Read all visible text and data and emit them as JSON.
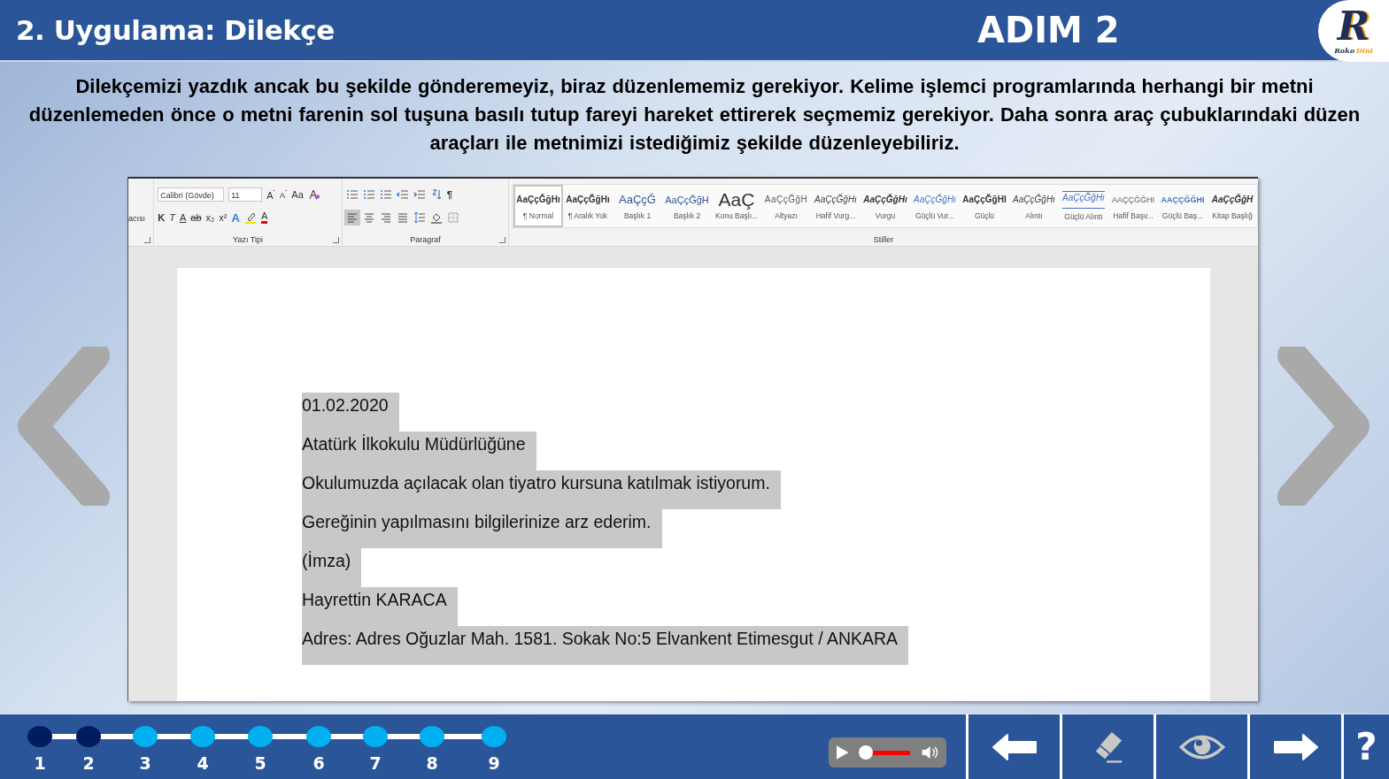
{
  "header": {
    "title": "2. Uygulama: Dilekçe",
    "step": "ADIM 2",
    "logo": {
      "letter": "R",
      "word_1": "Roko",
      "word_2": "Dini"
    }
  },
  "instructions": "Dilekçemizi yazdık ancak bu şekilde gönderemeyiz, biraz düzenlememiz gerekiyor. Kelime işlemci programlarında herhangi bir metni düzenlemeden önce o metni farenin sol tuşuna basılı tutup fareyi hareket ettirerek seçmemiz gerekiyor. Daha sonra araç çubuklarındaki düzen araçları ile metnimizi istediğimiz şekilde düzenleyebiliriz.",
  "ribbon": {
    "clipboard_fragment": "acısı",
    "font": {
      "name": "Calibri (Gövde)",
      "size": "11",
      "label": "Yazı Tipi",
      "row_1": [
        {
          "kind": "grow",
          "text": "A",
          "sign": "ˆ"
        },
        {
          "kind": "shrink",
          "text": "A",
          "sign": "ˇ"
        },
        {
          "kind": "case",
          "text": "Aa"
        },
        {
          "kind": "clear"
        }
      ],
      "row_2": [
        {
          "kind": "bold",
          "text": "K"
        },
        {
          "kind": "italic",
          "text": "T"
        },
        {
          "kind": "underline",
          "text": "A"
        },
        {
          "kind": "strike",
          "text": "ab"
        },
        {
          "kind": "sub",
          "text": "x₂"
        },
        {
          "kind": "sup",
          "text": "x²"
        },
        {
          "kind": "effect",
          "text": "A"
        },
        {
          "kind": "highlight"
        },
        {
          "kind": "color",
          "text": "A"
        }
      ]
    },
    "paragraph": {
      "label": "Paragraf",
      "row_1": [
        {
          "kind": "bullets"
        },
        {
          "kind": "numbering"
        },
        {
          "kind": "multilevel"
        },
        {
          "kind": "outdent"
        },
        {
          "kind": "indent"
        },
        {
          "kind": "sort"
        },
        {
          "kind": "marks",
          "text": "¶"
        }
      ],
      "alignment": [
        {
          "kind": "left",
          "selected": true
        },
        {
          "kind": "center",
          "selected": false
        },
        {
          "kind": "right",
          "selected": false
        },
        {
          "kind": "justify",
          "selected": false
        }
      ],
      "row_2": [
        {
          "kind": "spacing"
        },
        {
          "kind": "shading"
        },
        {
          "kind": "borders"
        }
      ]
    },
    "styles": {
      "label": "Stiller",
      "items": [
        {
          "preview": "AaÇçĞğHı",
          "name": "¶ Normal",
          "kind": "normal",
          "selected": true
        },
        {
          "preview": "AaÇçĞğHı",
          "name": "¶ Aralık Yok",
          "kind": "normal",
          "selected": false
        },
        {
          "preview": "AaÇçĞ",
          "name": "Başlık 1",
          "kind": "h1",
          "selected": false
        },
        {
          "preview": "AaÇçĞğH",
          "name": "Başlık 2",
          "kind": "h2",
          "selected": false
        },
        {
          "preview": "AaÇ",
          "name": "Konu Başlı...",
          "kind": "title",
          "selected": false
        },
        {
          "preview": "AaÇçĞğH",
          "name": "Altyazı",
          "kind": "subtitle",
          "selected": false
        },
        {
          "preview": "AaÇçĞğHı",
          "name": "Hafif Vurg...",
          "kind": "subtle",
          "selected": false
        },
        {
          "preview": "AaÇçĞğHı",
          "name": "Vurgu",
          "kind": "emphasis",
          "selected": false
        },
        {
          "preview": "AaÇçĞğHı",
          "name": "Güçlü Vur...",
          "kind": "intense",
          "selected": false
        },
        {
          "preview": "AaÇçĞğHI",
          "name": "Güçlü",
          "kind": "strong",
          "selected": false
        },
        {
          "preview": "AaÇçĞğHı",
          "name": "Alıntı",
          "kind": "subtle",
          "selected": false
        },
        {
          "preview": "AaÇçĞğHı",
          "name": "Güçlü Alıntı",
          "kind": "intense-quote",
          "selected": false
        },
        {
          "preview": "AAÇÇĞĞHI",
          "name": "Hafif Başv...",
          "kind": "subtle-ref",
          "selected": false
        },
        {
          "preview": "AAÇÇĞĞHI",
          "name": "Güçlü Baş...",
          "kind": "intense-ref",
          "selected": false
        },
        {
          "preview": "AaÇçĞğH",
          "name": "Kitap Başlığ",
          "kind": "book",
          "selected": false
        }
      ]
    }
  },
  "document": {
    "lines": [
      {
        "text": "01.02.2020",
        "selected": true
      },
      {
        "text": "Atatürk İlkokulu Müdürlüğüne",
        "selected": true
      },
      {
        "text": "Okulumuzda açılacak olan tiyatro kursuna katılmak istiyorum.",
        "selected": true
      },
      {
        "text": "Gereğinin yapılmasını bilgilerinize arz ederim.",
        "selected": true
      },
      {
        "text": "(İmza)",
        "selected": true
      },
      {
        "text": "Hayrettin KARACA",
        "selected": true
      },
      {
        "text": "Adres: Adres Oğuzlar Mah. 1581. Sokak No:5 Elvankent Etimesgut / ANKARA",
        "selected": true
      }
    ]
  },
  "steps": [
    {
      "label": "1",
      "completed": true
    },
    {
      "label": "2",
      "completed": true
    },
    {
      "label": "3",
      "completed": false
    },
    {
      "label": "4",
      "completed": false
    },
    {
      "label": "5",
      "completed": false
    },
    {
      "label": "6",
      "completed": false
    },
    {
      "label": "7",
      "completed": false
    },
    {
      "label": "8",
      "completed": false
    },
    {
      "label": "9",
      "completed": false
    }
  ],
  "player": {
    "playing": false,
    "level": 0
  },
  "nav_buttons": [
    {
      "kind": "back"
    },
    {
      "kind": "eraser"
    },
    {
      "kind": "eye"
    },
    {
      "kind": "forward"
    },
    {
      "kind": "help",
      "text": "?"
    }
  ]
}
